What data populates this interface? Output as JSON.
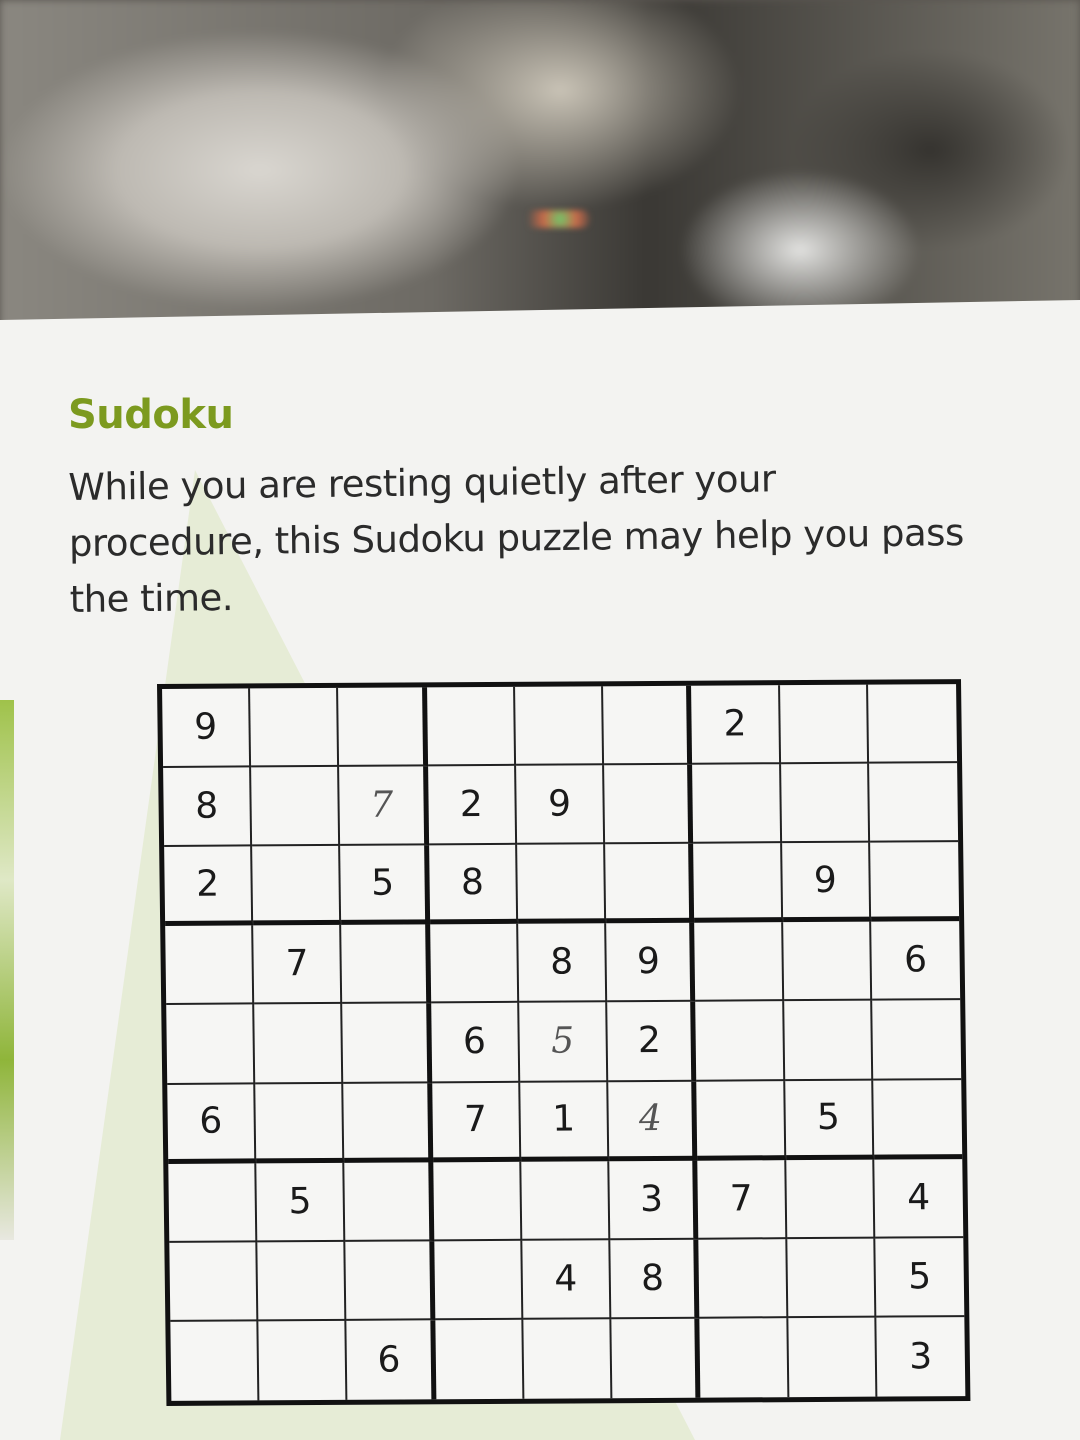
{
  "card": {
    "title": "Sudoku",
    "description": "While you are resting quietly after your procedure, this Sudoku puzzle may help you pass the time.",
    "accent_color": "#7c9a1f"
  },
  "puzzle": {
    "rows": [
      [
        "9",
        "",
        "",
        "",
        "",
        "",
        "2",
        "",
        ""
      ],
      [
        "8",
        "",
        "7",
        "2",
        "9",
        "",
        "",
        "",
        ""
      ],
      [
        "2",
        "",
        "5",
        "8",
        "",
        "",
        "",
        "9",
        ""
      ],
      [
        "",
        "7",
        "",
        "",
        "8",
        "9",
        "",
        "",
        "6"
      ],
      [
        "",
        "",
        "",
        "6",
        "5",
        "2",
        "",
        "",
        ""
      ],
      [
        "6",
        "",
        "",
        "7",
        "1",
        "4",
        "",
        "5",
        ""
      ],
      [
        "",
        "5",
        "",
        "",
        "",
        "3",
        "7",
        "",
        "4"
      ],
      [
        "",
        "",
        "",
        "",
        "4",
        "8",
        "",
        "",
        "5"
      ],
      [
        "",
        "",
        "6",
        "",
        "",
        "",
        "",
        "",
        "3"
      ]
    ],
    "handwritten_cells": [
      [
        1,
        2
      ],
      [
        4,
        4
      ],
      [
        5,
        5
      ]
    ]
  }
}
